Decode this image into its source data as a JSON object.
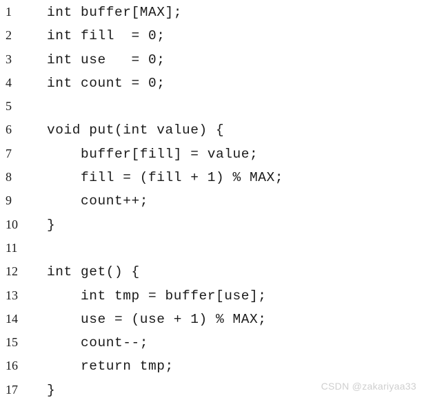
{
  "document": {
    "type": "source-code-listing",
    "language": "C",
    "background_color": "#ffffff",
    "text_color": "#1a1a1a",
    "line_count": 17,
    "lines": [
      {
        "number": "1",
        "code": "int buffer[MAX];"
      },
      {
        "number": "2",
        "code": "int fill  = 0;"
      },
      {
        "number": "3",
        "code": "int use   = 0;"
      },
      {
        "number": "4",
        "code": "int count = 0;"
      },
      {
        "number": "5",
        "code": ""
      },
      {
        "number": "6",
        "code": "void put(int value) {"
      },
      {
        "number": "7",
        "code": "    buffer[fill] = value;"
      },
      {
        "number": "8",
        "code": "    fill = (fill + 1) % MAX;"
      },
      {
        "number": "9",
        "code": "    count++;"
      },
      {
        "number": "10",
        "code": "}"
      },
      {
        "number": "11",
        "code": ""
      },
      {
        "number": "12",
        "code": "int get() {"
      },
      {
        "number": "13",
        "code": "    int tmp = buffer[use];"
      },
      {
        "number": "14",
        "code": "    use = (use + 1) % MAX;"
      },
      {
        "number": "15",
        "code": "    count--;"
      },
      {
        "number": "16",
        "code": "    return tmp;"
      },
      {
        "number": "17",
        "code": "}"
      }
    ]
  },
  "watermark": {
    "text": "CSDN @zakariyaa33",
    "color": "#cfcfcf"
  }
}
